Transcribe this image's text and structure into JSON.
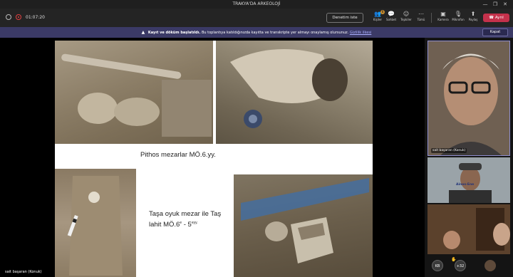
{
  "window": {
    "title": "TRAKYA'DA ARKEOLOJİ",
    "controls": [
      "—",
      "❐",
      "✕"
    ]
  },
  "toolbar": {
    "timer": "01:07:20",
    "meeting_notes_label": "Denetim iste",
    "people": {
      "label": "Kişiler",
      "badge": "6"
    },
    "chat": {
      "label": "Sohbet"
    },
    "reactions": {
      "label": "Tepkiler"
    },
    "more": {
      "label": "Tümü"
    },
    "camera": {
      "label": "Kamera"
    },
    "mic": {
      "label": "Mikrofon"
    },
    "share": {
      "label": "Paylaş"
    },
    "leave_label": "Ayrıl"
  },
  "banner": {
    "bold": "Kayıt ve döküm başlatıldı.",
    "text": "Bu toplantıya katıldığınızda kayıtta ve transkripte yer almayı onaylamış olursunuz.",
    "link": "Gizlilik ilkesi",
    "close_label": "Kapat"
  },
  "slide": {
    "caption1": "Pithos mezarlar MÖ.6.yy.",
    "caption2_line1": "Taşa oyuk mezar ile Taş",
    "caption2_line2a": "lahit MÖ.6",
    "caption2_sup1": "e",
    "caption2_line2b": " - 5",
    "caption2_sup2": "eyy."
  },
  "stage": {
    "presenter_name": "sait başaran (Konuk)"
  },
  "participants": {
    "tile1_name": "sait başaran (Konuk)",
    "tile2_overlay": "Ainos-Ene",
    "kb_initials": "KB",
    "more_count": "+32"
  },
  "colors": {
    "leave": "#c4314b",
    "banner": "#3b3a66",
    "active_border": "#8f8fd0"
  }
}
